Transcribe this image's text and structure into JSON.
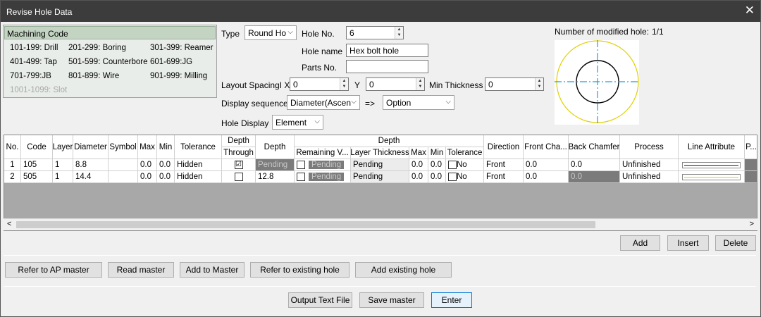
{
  "window": {
    "title": "Revise Hole Data",
    "close_glyph": "✕"
  },
  "machining_code": {
    "header": "Machining Code",
    "codes": [
      "101-199: Drill",
      "201-299: Boring",
      "301-399: Reamer",
      "401-499: Tap",
      "501-599: Counterbore",
      "601-699:JG",
      "701-799:JB",
      "801-899: Wire",
      "901-999: Milling",
      "1001-1099: Slot"
    ]
  },
  "form": {
    "type_label": "Type",
    "type_value": "Round Ho",
    "hole_no_label": "Hole No.",
    "hole_no_value": "6",
    "hole_name_label": "Hole name",
    "hole_name_value": "Hex bolt hole",
    "parts_no_label": "Parts No.",
    "parts_no_value": "",
    "layout_x_label": "Layout SpacingI X",
    "layout_x_value": "0",
    "y_label": "Y",
    "y_value": "0",
    "min_thickness_label": "Min Thickness",
    "min_thickness_value": "0",
    "display_seq_label": "Display sequence",
    "display_seq_value": "Diameter(Ascen",
    "arrow_label": "=>",
    "option_value": "Option",
    "hole_display_label": "Hole Display",
    "hole_display_value": "Element"
  },
  "preview": {
    "label": "Number of modified hole:",
    "count": "1/1",
    "outer_color": "#e0d000",
    "center_color": "#1aa0e0"
  },
  "grid": {
    "headers": {
      "no": "No.",
      "code": "Code",
      "layer": "Layer",
      "diameter": "Diameter",
      "symbol": "Symbol",
      "max": "Max",
      "min": "Min",
      "tolerance": "Tolerance",
      "depth_group1": "Depth",
      "through": "Through",
      "depth": "Depth",
      "depth_group2": "Depth",
      "remaining": "Remaining V...",
      "layer_thickness": "Layer Thickness",
      "max2": "Max",
      "min2": "Min",
      "tolerance2": "Tolerance",
      "direction": "Direction",
      "front_chamfer": "Front Cha...",
      "back_chamfer": "Back Chamfer",
      "process": "Process",
      "line_attr": "Line Attribute",
      "p": "P..."
    },
    "rows": [
      {
        "no": "1",
        "code": "105",
        "layer": "1",
        "diameter": "8.8",
        "symbol": "",
        "max": "0.0",
        "min": "0.0",
        "tolerance": "Hidden",
        "through": "☑",
        "depth": "Pending",
        "remaining": "Pending",
        "layer_thickness": "Pending",
        "max2": "0.0",
        "min2": "0.0",
        "tol2": "No",
        "direction": "Front",
        "front_chamfer": "0.0",
        "back_chamfer": "0.0",
        "process": "Unfinished",
        "line_color": "#222222"
      },
      {
        "no": "2",
        "code": "505",
        "layer": "1",
        "diameter": "14.4",
        "symbol": "",
        "max": "0.0",
        "min": "0.0",
        "tolerance": "Hidden",
        "through": "",
        "depth": "12.8",
        "remaining": "Pending",
        "layer_thickness": "Pending",
        "max2": "0.0",
        "min2": "0.0",
        "tol2": "No",
        "direction": "Front",
        "front_chamfer": "0.0",
        "back_chamfer": "0.0",
        "process": "Unfinished",
        "line_color": "#e0d000"
      }
    ]
  },
  "buttons": {
    "add": "Add",
    "insert": "Insert",
    "delete": "Delete",
    "refer_ap": "Refer to AP master",
    "read_master": "Read master",
    "add_master": "Add to Master",
    "refer_existing": "Refer to existing hole",
    "add_existing": "Add existing hole",
    "output_text": "Output Text File",
    "save_master": "Save master",
    "enter": "Enter"
  }
}
